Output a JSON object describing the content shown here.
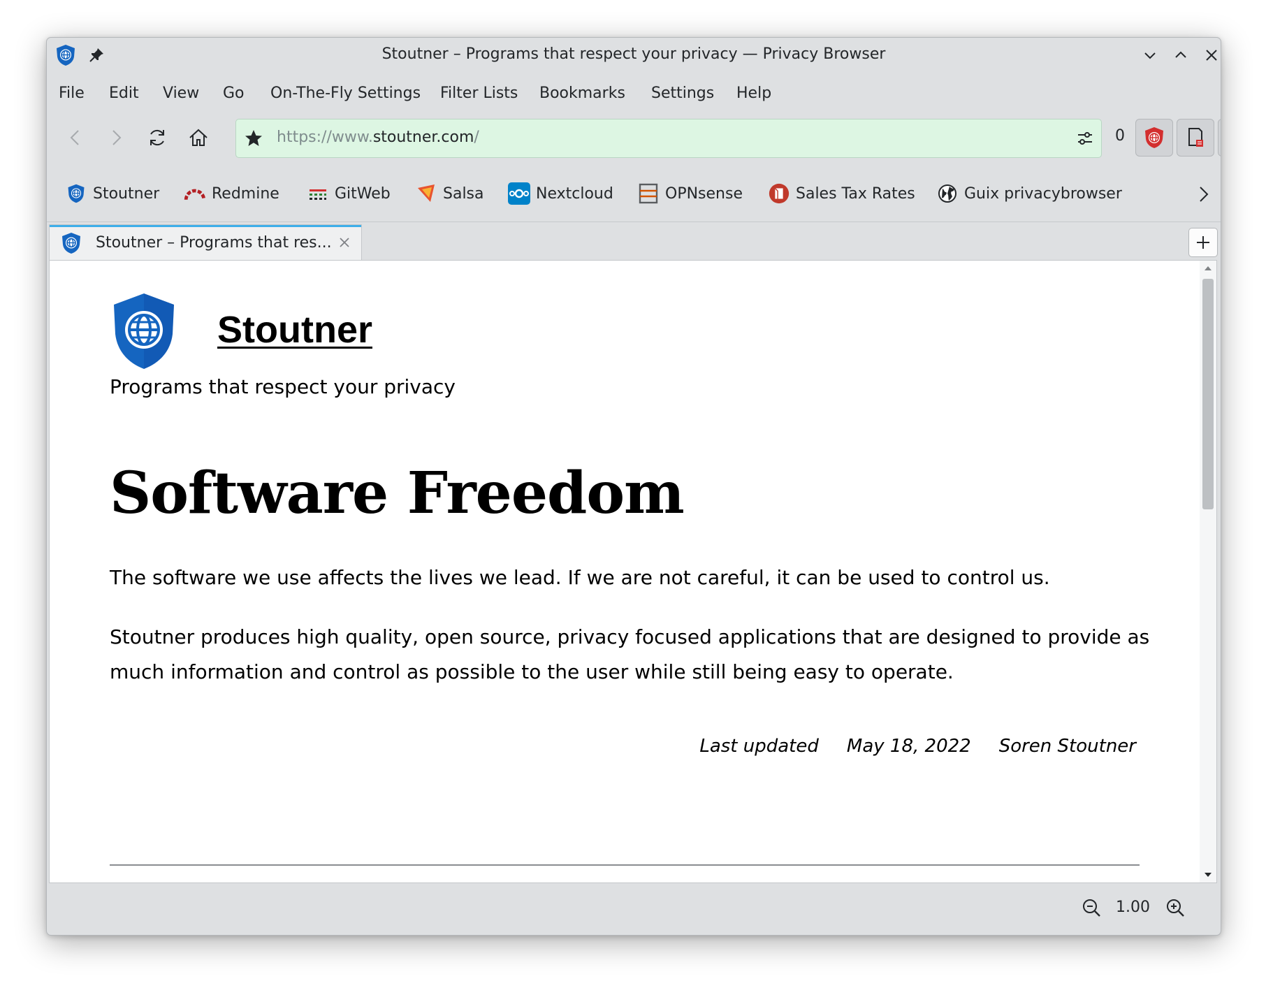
{
  "window": {
    "title": "Stoutner – Programs that respect your privacy — Privacy Browser",
    "controls": [
      "minimize",
      "maximize",
      "close"
    ]
  },
  "menu": {
    "items": [
      "File",
      "Edit",
      "View",
      "Go",
      "On-The-Fly Settings",
      "Filter Lists",
      "Bookmarks",
      "Settings",
      "Help"
    ]
  },
  "toolbar": {
    "url_prefix": "https://www.",
    "url_host": "stoutner.com",
    "url_suffix": "/",
    "counter": "0"
  },
  "bookmarks": {
    "items": [
      {
        "label": "Stoutner",
        "icon": "stoutner-shield-icon"
      },
      {
        "label": "Redmine",
        "icon": "redmine-icon"
      },
      {
        "label": "GitWeb",
        "icon": "gitweb-icon"
      },
      {
        "label": "Salsa",
        "icon": "salsa-icon"
      },
      {
        "label": "Nextcloud",
        "icon": "nextcloud-icon"
      },
      {
        "label": "OPNsense",
        "icon": "opnsense-icon"
      },
      {
        "label": "Sales Tax Rates",
        "icon": "sales-tax-icon"
      },
      {
        "label": "Guix privacybrowser",
        "icon": "globe-icon"
      }
    ]
  },
  "tab": {
    "label": "Stoutner – Programs that res..."
  },
  "page": {
    "site_name": "Stoutner",
    "tagline": "Programs that respect your privacy",
    "heading": "Software Freedom",
    "paragraph1": "The software we use affects the lives we lead. If we are not careful, it can be used to control us.",
    "paragraph2": "Stoutner produces high quality, open source, privacy focused applications that are designed to provide as much information and control as possible to the user while still being easy to operate.",
    "last_updated_label": "Last updated",
    "last_updated_date": "May 18, 2022",
    "author": "Soren Stoutner"
  },
  "status": {
    "zoom": "1.00"
  },
  "colors": {
    "url_background": "#ddf6e3",
    "tab_accent": "#3daee9",
    "shield_blue": "#1565c0"
  }
}
